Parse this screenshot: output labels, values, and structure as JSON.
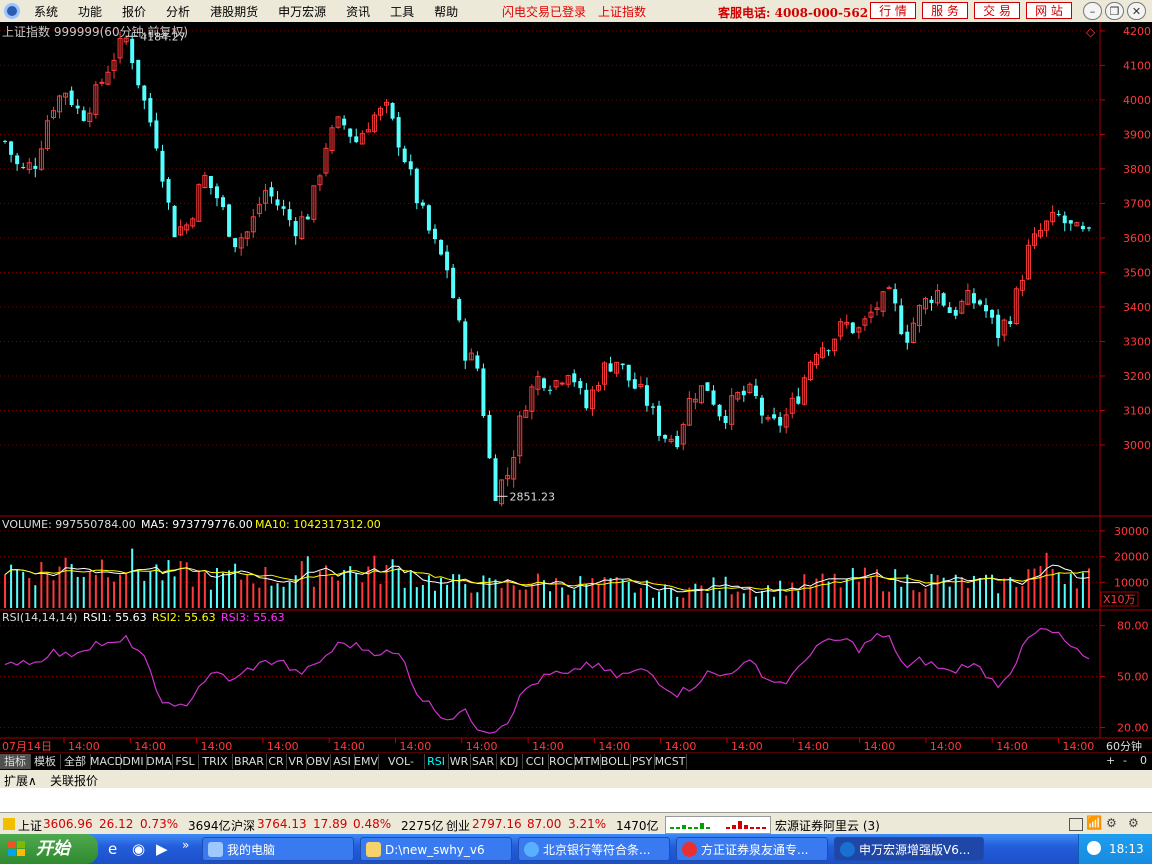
{
  "menu": {
    "items": [
      "系统",
      "功能",
      "报价",
      "分析",
      "港股期货",
      "申万宏源",
      "资讯",
      "工具",
      "帮助"
    ],
    "flash_status": "闪电交易已登录",
    "index_link": "上证指数",
    "hotline": "客服电话: 4008-000-562",
    "buttons": [
      "行 情",
      "服 务",
      "交 易",
      "网 站"
    ]
  },
  "chart": {
    "title": "上证指数 999999(60分钟,前复权)",
    "high_label": "4184.27",
    "low_label": "2851.23",
    "volume_header": {
      "label": "VOLUME: 997550784.00",
      "ma5": "MA5: 973779776.00",
      "ma10": "MA10: 1042317312.00"
    },
    "vol_unit": "X10万",
    "rsi_header": {
      "label": "RSI(14,14,14)",
      "rsi1": "RSI1: 55.63",
      "rsi2": "RSI2: 55.63",
      "rsi3": "RSI3: 55.63"
    },
    "period": "60分钟",
    "date_first": "07月14日",
    "time_label": "14:00",
    "time_count": 16,
    "colors": {
      "up": "#ff3a3a",
      "down": "#54ffff",
      "ma5": "#ffffff",
      "ma10": "#ffff00",
      "rsi": "#cc33cc",
      "grid": "#7a0000"
    }
  },
  "chart_data": {
    "type": "candlestick",
    "series_name": "上证指数",
    "y_axis_ticks": [
      4200,
      4100,
      4000,
      3900,
      3800,
      3700,
      3600,
      3500,
      3400,
      3300,
      3200,
      3100,
      3000
    ],
    "ylim": [
      2800,
      4220
    ],
    "volume_axis_ticks": [
      30000,
      20000,
      10000
    ],
    "volume_ylim": [
      0,
      35000
    ],
    "rsi_axis_ticks": [
      80.0,
      50.0,
      20.0
    ],
    "rsi_ylim": [
      15,
      88
    ],
    "close_path": [
      3880,
      3790,
      3820,
      3980,
      4030,
      3950,
      4020,
      4120,
      4180,
      4010,
      3870,
      3620,
      3640,
      3780,
      3710,
      3590,
      3620,
      3740,
      3690,
      3630,
      3680,
      3870,
      3940,
      3880,
      3950,
      3970,
      3860,
      3710,
      3590,
      3510,
      3280,
      3220,
      2860,
      2920,
      3120,
      3200,
      3180,
      3230,
      3100,
      3210,
      3250,
      3180,
      3130,
      3030,
      3020,
      3150,
      3170,
      3080,
      3140,
      3150,
      3050,
      3070,
      3150,
      3280,
      3300,
      3350,
      3330,
      3400,
      3430,
      3310,
      3400,
      3450,
      3380,
      3420,
      3410,
      3320,
      3390,
      3560,
      3630,
      3660,
      3620,
      3600
    ],
    "volume_path": [
      16000,
      14000,
      15000,
      13500,
      17000,
      15500,
      16500,
      18000,
      17000,
      15000,
      14000,
      12500,
      13000,
      12000,
      11500,
      12500,
      13000,
      12000,
      11000,
      12500,
      14500,
      16000,
      15500,
      13500,
      14500,
      15000,
      14000,
      12000,
      10500,
      9000,
      10000,
      9500,
      8500,
      9000,
      9500,
      10000,
      9500,
      9000,
      9500,
      8500,
      9000,
      8000,
      7500,
      6500,
      7000,
      7500,
      8000,
      9000,
      8500,
      8000,
      7500,
      8000,
      9000,
      9500,
      10000,
      10500,
      11000,
      11500,
      11000,
      10500,
      11000,
      10500,
      9500,
      10000,
      9500,
      9000,
      10000,
      14000,
      16000,
      15500,
      14000,
      12000
    ],
    "rsi_path": [
      55,
      60,
      58,
      65,
      62,
      66,
      70,
      68,
      72,
      63,
      40,
      30,
      35,
      48,
      52,
      47,
      55,
      58,
      60,
      52,
      54,
      62,
      70,
      68,
      65,
      64,
      62,
      40,
      32,
      25,
      30,
      20,
      18,
      25,
      42,
      48,
      52,
      50,
      58,
      55,
      50,
      52,
      54,
      46,
      40,
      44,
      52,
      50,
      56,
      58,
      48,
      46,
      54,
      68,
      70,
      72,
      66,
      74,
      72,
      54,
      60,
      56,
      52,
      58,
      54,
      45,
      55,
      72,
      78,
      74,
      66,
      58
    ]
  },
  "tabs": [
    "指标",
    "模板",
    "全部",
    "MACD",
    "DMI",
    "DMA",
    "FSL",
    "TRIX",
    "BRAR",
    "CR",
    "VR",
    "OBV",
    "ASI",
    "EMV",
    "VOL-TDX",
    "RSI",
    "WR",
    "SAR",
    "KDJ",
    "CCI",
    "ROC",
    "MTM",
    "BOLL",
    "PSY",
    "MCST"
  ],
  "tab_right": [
    "+",
    "-",
    "0"
  ],
  "ext_tabs": [
    "扩展∧",
    "关联报价"
  ],
  "status": {
    "sh_name": "上证",
    "sh_value": "3606.96",
    "sh_change": "26.12",
    "sh_pct": "0.73%",
    "sh_amount": "3694亿",
    "hs_name": "沪深",
    "hs_value": "3764.13",
    "hs_change": "17.89",
    "hs_pct": "0.48%",
    "hs_amount": "2275亿",
    "cy_name": "创业",
    "cy_value": "2797.16",
    "cy_change": "87.00",
    "cy_pct": "3.21%",
    "cy_amount": "1470亿",
    "broker": "宏源证券阿里云 (3)"
  },
  "taskbar": {
    "start": "开始",
    "windows": [
      "我的电脑",
      "D:\\new_swhy_v6",
      "北京银行等符合条...",
      "方正证券泉友通专...",
      "申万宏源增强版V6..."
    ],
    "clock": "18:13"
  }
}
